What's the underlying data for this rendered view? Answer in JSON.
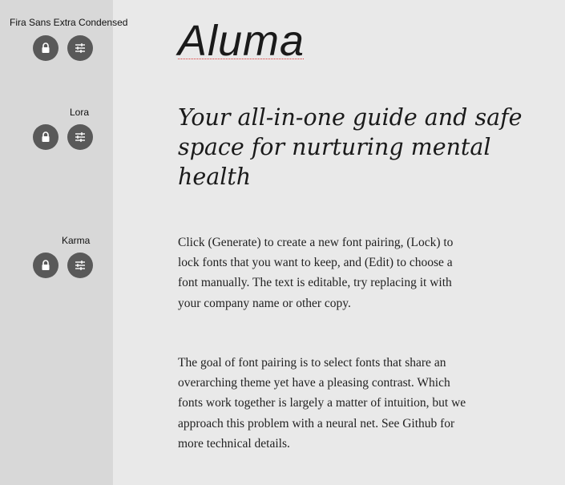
{
  "fonts": [
    {
      "name": "Fira Sans Extra Condensed",
      "lock_icon": "lock-icon",
      "edit_icon": "sliders-icon"
    },
    {
      "name": "Lora",
      "lock_icon": "lock-icon",
      "edit_icon": "sliders-icon"
    },
    {
      "name": "Karma",
      "lock_icon": "lock-icon",
      "edit_icon": "sliders-icon"
    }
  ],
  "logo": "Aluma",
  "headline": "Your all-in-one guide and safe space for nurturing mental health",
  "paragraphs": [
    "Click (Generate) to create a new font pairing, (Lock) to lock fonts that you want to keep, and (Edit) to choose a font manually. The text is editable, try replacing it with your company name or other copy.",
    "The goal of font pairing is to select fonts that share an overarching theme yet have a pleasing contrast. Which fonts work together is largely a matter of intuition, but we approach this problem with a neural net. See Github for more technical details."
  ],
  "colors": {
    "sidebar_bg": "#d8d8d8",
    "page_bg": "#e9e9e9",
    "button_bg": "#595959",
    "icon_fg": "#ffffff",
    "spellcheck_underline": "#dd3333"
  }
}
